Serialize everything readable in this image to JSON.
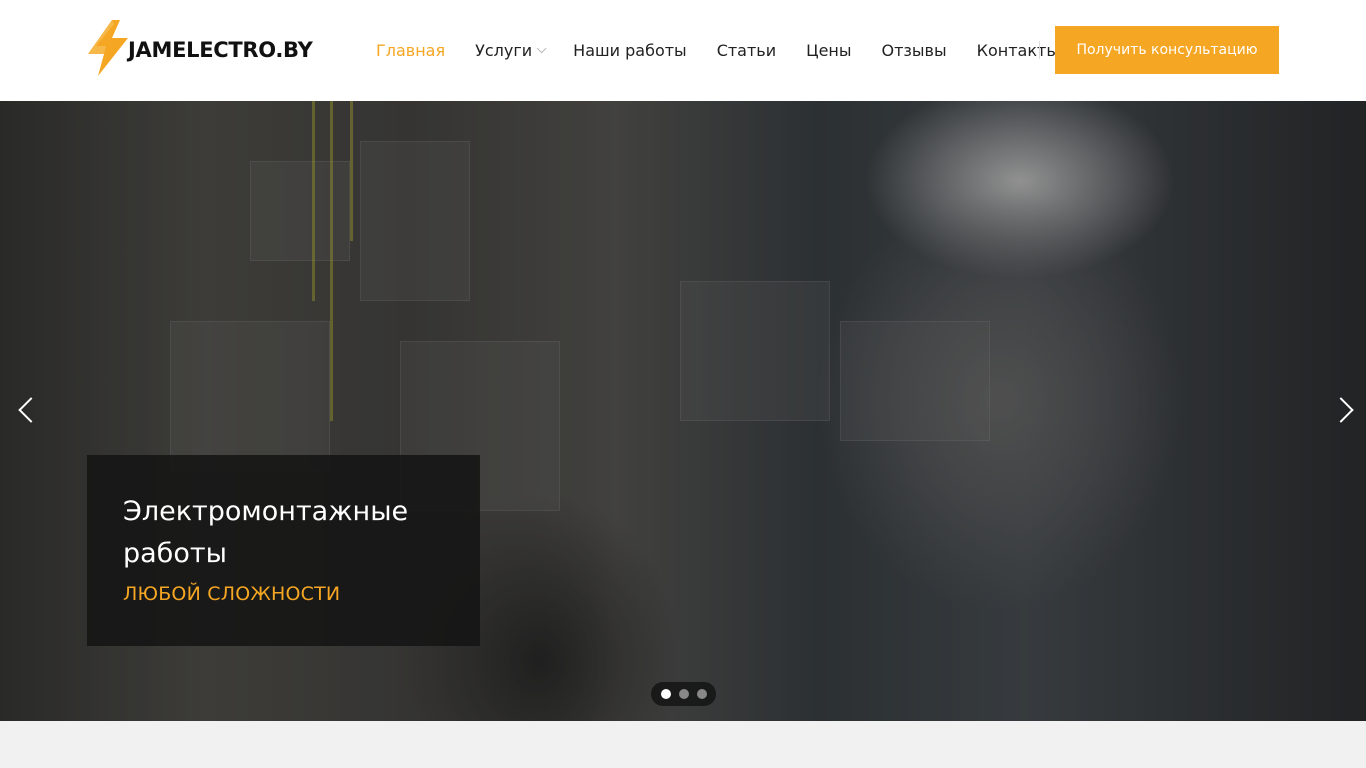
{
  "brand": {
    "logo_text": "JAMELECTRO.BY",
    "accent_color": "#f5a623",
    "logo_icon": "lightning-bolt-icon"
  },
  "nav": {
    "items": [
      {
        "label": "Главная",
        "active": true
      },
      {
        "label": "Услуги",
        "has_dropdown": true
      },
      {
        "label": "Наши работы"
      },
      {
        "label": "Статьи"
      },
      {
        "label": "Цены"
      },
      {
        "label": "Отзывы"
      },
      {
        "label": "Контакты"
      }
    ],
    "cta_label": "Получить консультацию"
  },
  "hero": {
    "title": "Электромонтажные работы",
    "subtitle": "любой сложности",
    "prev_icon": "chevron-left-icon",
    "next_icon": "chevron-right-icon",
    "slides_count": 3,
    "active_slide": 1
  }
}
